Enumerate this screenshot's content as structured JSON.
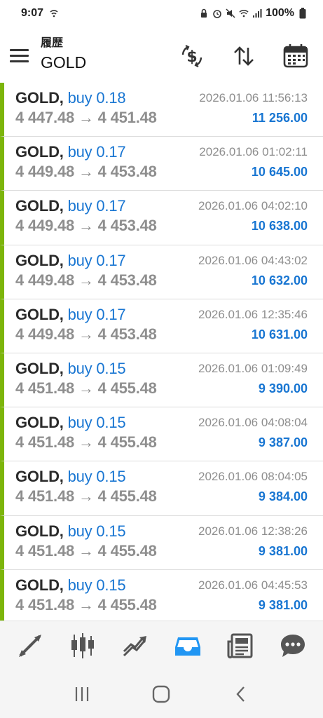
{
  "status_bar": {
    "time": "9:07",
    "battery": "100%"
  },
  "header": {
    "subtitle": "履歴",
    "title": "GOLD",
    "icons": [
      "currency-exchange-icon",
      "sort-icon",
      "calendar-icon"
    ]
  },
  "trades": [
    {
      "symbol": "GOLD",
      "side": "buy 0.18",
      "prices": "4 447.48 → 4 451.48",
      "time": "2026.01.06 11:56:13",
      "profit": "11 256.00"
    },
    {
      "symbol": "GOLD",
      "side": "buy 0.17",
      "prices": "4 449.48 → 4 453.48",
      "time": "2026.01.06 01:02:11",
      "profit": "10 645.00"
    },
    {
      "symbol": "GOLD",
      "side": "buy 0.17",
      "prices": "4 449.48 → 4 453.48",
      "time": "2026.01.06 04:02:10",
      "profit": "10 638.00"
    },
    {
      "symbol": "GOLD",
      "side": "buy 0.17",
      "prices": "4 449.48 → 4 453.48",
      "time": "2026.01.06 04:43:02",
      "profit": "10 632.00"
    },
    {
      "symbol": "GOLD",
      "side": "buy 0.17",
      "prices": "4 449.48 → 4 453.48",
      "time": "2026.01.06 12:35:46",
      "profit": "10 631.00"
    },
    {
      "symbol": "GOLD",
      "side": "buy 0.15",
      "prices": "4 451.48 → 4 455.48",
      "time": "2026.01.06 01:09:49",
      "profit": "9 390.00"
    },
    {
      "symbol": "GOLD",
      "side": "buy 0.15",
      "prices": "4 451.48 → 4 455.48",
      "time": "2026.01.06 04:08:04",
      "profit": "9 387.00"
    },
    {
      "symbol": "GOLD",
      "side": "buy 0.15",
      "prices": "4 451.48 → 4 455.48",
      "time": "2026.01.06 08:04:05",
      "profit": "9 384.00"
    },
    {
      "symbol": "GOLD",
      "side": "buy 0.15",
      "prices": "4 451.48 → 4 455.48",
      "time": "2026.01.06 12:38:26",
      "profit": "9 381.00"
    },
    {
      "symbol": "GOLD",
      "side": "buy 0.15",
      "prices": "4 451.48 → 4 455.48",
      "time": "2026.01.06 04:45:53",
      "profit": "9 381.00"
    }
  ],
  "tabs": [
    {
      "icon": "quotes-icon",
      "active": false
    },
    {
      "icon": "chart-candles-icon",
      "active": false
    },
    {
      "icon": "trade-icon",
      "active": false
    },
    {
      "icon": "history-inbox-icon",
      "active": true
    },
    {
      "icon": "news-icon",
      "active": false
    },
    {
      "icon": "messages-icon",
      "active": false
    }
  ],
  "colors": {
    "accent": "#1976d2",
    "profit_bar": "#7cb50b",
    "muted": "#8e8e8e"
  }
}
